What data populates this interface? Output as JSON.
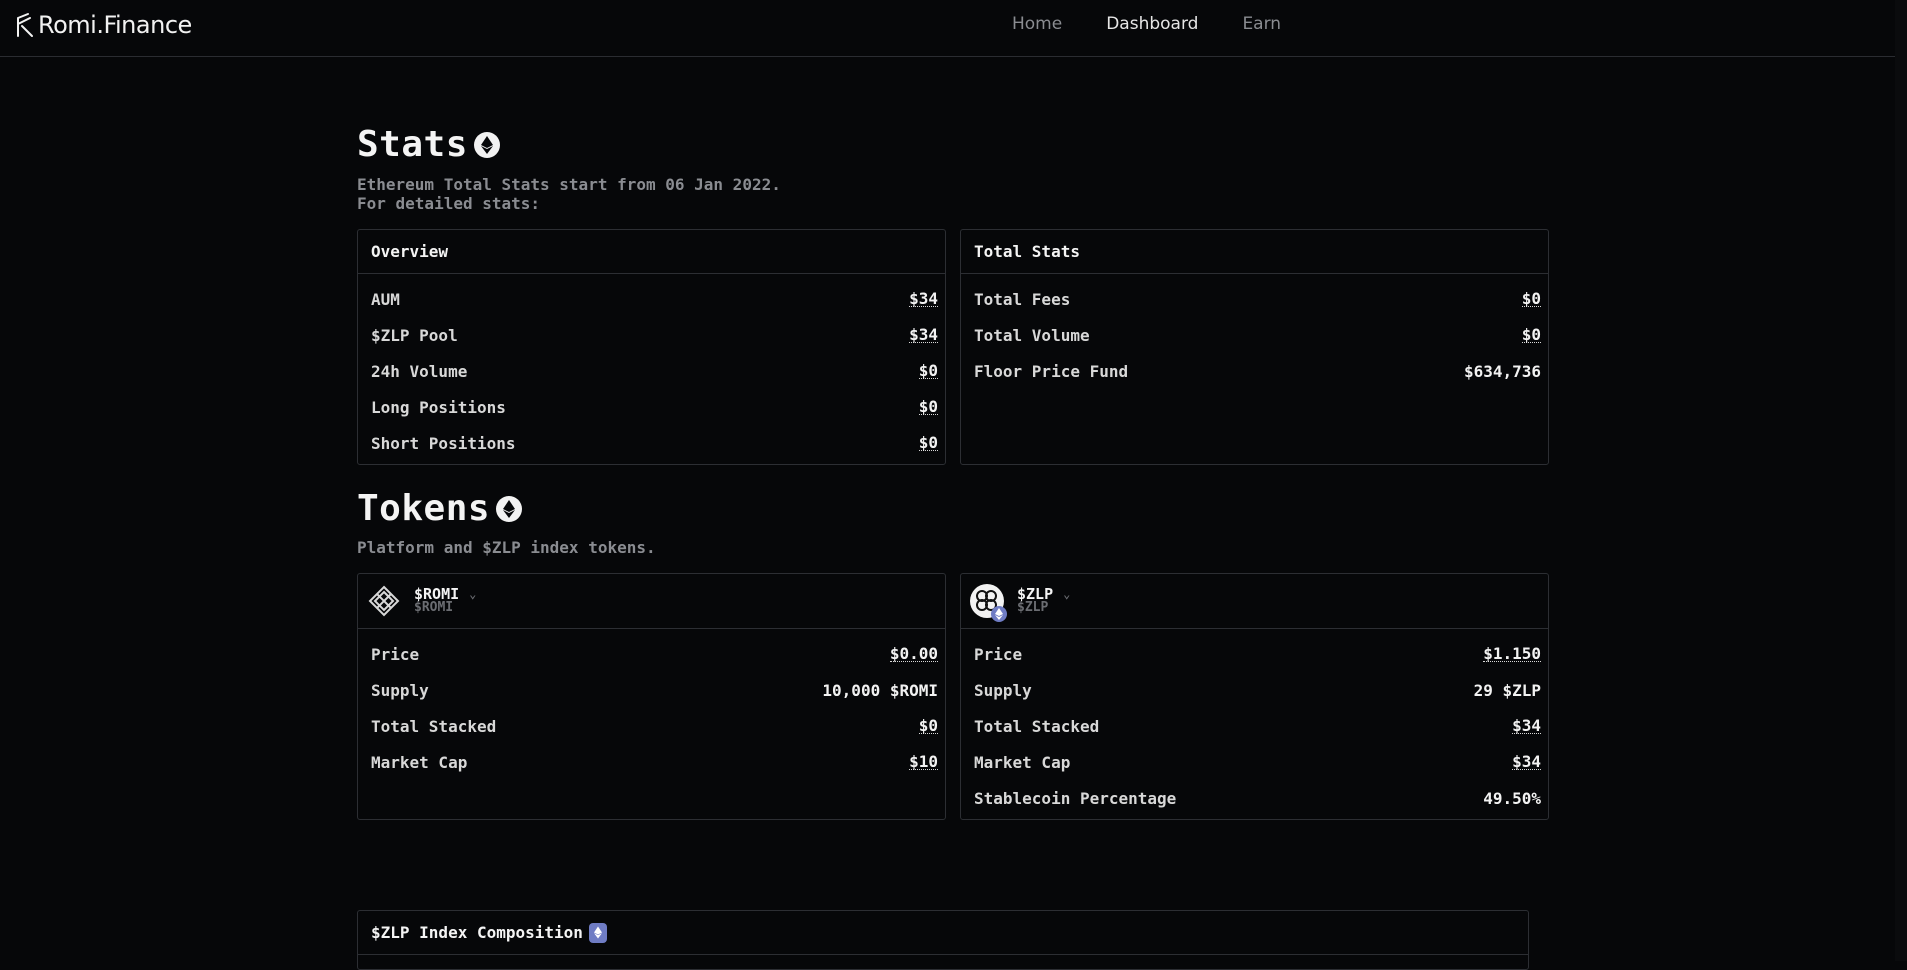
{
  "header": {
    "logo_text": "Romi.Finance",
    "nav": [
      {
        "label": "Home",
        "active": false
      },
      {
        "label": "Dashboard",
        "active": true
      },
      {
        "label": "Earn",
        "active": false
      }
    ]
  },
  "stats": {
    "title": "Stats",
    "subtitle_line1": "Ethereum Total Stats start from 06 Jan 2022.",
    "subtitle_line2": "For detailed stats:",
    "overview": {
      "title": "Overview",
      "rows": [
        {
          "label": "AUM",
          "value": "$34"
        },
        {
          "label": "$ZLP Pool",
          "value": "$34"
        },
        {
          "label": "24h Volume",
          "value": "$0"
        },
        {
          "label": "Long Positions",
          "value": "$0"
        },
        {
          "label": "Short Positions",
          "value": "$0"
        }
      ]
    },
    "total": {
      "title": "Total Stats",
      "rows": [
        {
          "label": "Total Fees",
          "value": "$0"
        },
        {
          "label": "Total Volume",
          "value": "$0"
        },
        {
          "label": "Floor Price Fund",
          "value": "$634,736"
        }
      ]
    }
  },
  "tokens": {
    "title": "Tokens",
    "subtitle": "Platform and $ZLP index tokens.",
    "romi": {
      "name": "$ROMI",
      "symbol": "$ROMI",
      "rows": [
        {
          "label": "Price",
          "value": "$0.00"
        },
        {
          "label": "Supply",
          "value": "10,000 $ROMI"
        },
        {
          "label": "Total Stacked",
          "value": "$0"
        },
        {
          "label": "Market Cap",
          "value": "$10"
        }
      ]
    },
    "zlp": {
      "name": "$ZLP",
      "symbol": "$ZLP",
      "rows": [
        {
          "label": "Price",
          "value": "$1.150"
        },
        {
          "label": "Supply",
          "value": "29 $ZLP"
        },
        {
          "label": "Total Stacked",
          "value": "$34"
        },
        {
          "label": "Market Cap",
          "value": "$34"
        },
        {
          "label": "Stablecoin Percentage",
          "value": "49.50%"
        }
      ]
    }
  },
  "composition": {
    "title": "$ZLP Index Composition"
  },
  "icons": {
    "chain": "ethereum-icon",
    "romi": "romi-knot-icon",
    "zlp": "zlp-token-icon",
    "dropdown": "chevron-down-icon"
  },
  "colors": {
    "background": "#060709",
    "border": "#2c2e33",
    "muted_text": "#8a8c91",
    "eth_badge": "#6f7cc4"
  }
}
